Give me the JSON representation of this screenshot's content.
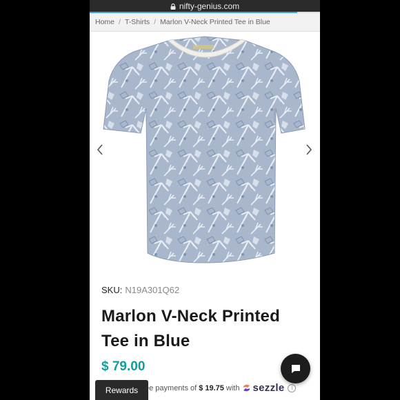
{
  "browser": {
    "url": "nifty-genius.com",
    "load_progress": 0.9
  },
  "breadcrumb": {
    "items": [
      "Home",
      "T-Shirts",
      "Marlon V-Neck Printed Tee in Blue"
    ],
    "separator": "/"
  },
  "product": {
    "sku_label": "SKU:",
    "sku": "N19A301Q62",
    "title_line1": "Marlon V-Neck Printed",
    "title_line2": "Tee in Blue",
    "price": "$ 79.00",
    "image_alt": "blue tropical print v-neck t-shirt"
  },
  "installments": {
    "prefix": "ee payments of",
    "amount": "$ 19.75",
    "with": "with",
    "provider": "sezzle",
    "info": "i"
  },
  "rewards_label": "Rewards",
  "icons": {
    "lock": "lock-icon",
    "prev": "chevron-left-icon",
    "next": "chevron-right-icon",
    "chat": "chat-icon",
    "sezzle": "sezzle-logo-icon",
    "info": "info-icon"
  },
  "colors": {
    "price": "#169b9b",
    "loadbar": "#3aa0f2",
    "rewards_bg": "#2a2a2a",
    "chat_bg": "#1d1d1d"
  }
}
